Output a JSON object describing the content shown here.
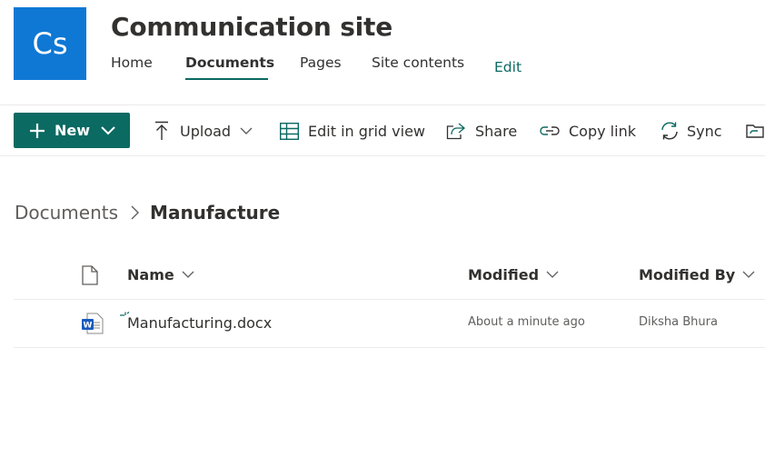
{
  "site": {
    "logo_initials": "Cs",
    "title": "Communication site",
    "nav": [
      "Home",
      "Documents",
      "Pages",
      "Site contents"
    ],
    "nav_active": "Documents",
    "edit_label": "Edit"
  },
  "commands": {
    "new_label": "New",
    "upload_label": "Upload",
    "grid_label": "Edit in grid view",
    "share_label": "Share",
    "copy_link_label": "Copy link",
    "sync_label": "Sync"
  },
  "breadcrumb": {
    "root": "Documents",
    "current": "Manufacture"
  },
  "list": {
    "columns": {
      "name": "Name",
      "modified": "Modified",
      "modified_by": "Modified By"
    },
    "rows": [
      {
        "icon": "word-doc-icon",
        "name": "Manufacturing.docx",
        "modified": "About a minute ago",
        "modified_by": "Diksha Bhura"
      }
    ]
  },
  "colors": {
    "accent": "#0b6a62",
    "logo": "#0f78d4"
  }
}
